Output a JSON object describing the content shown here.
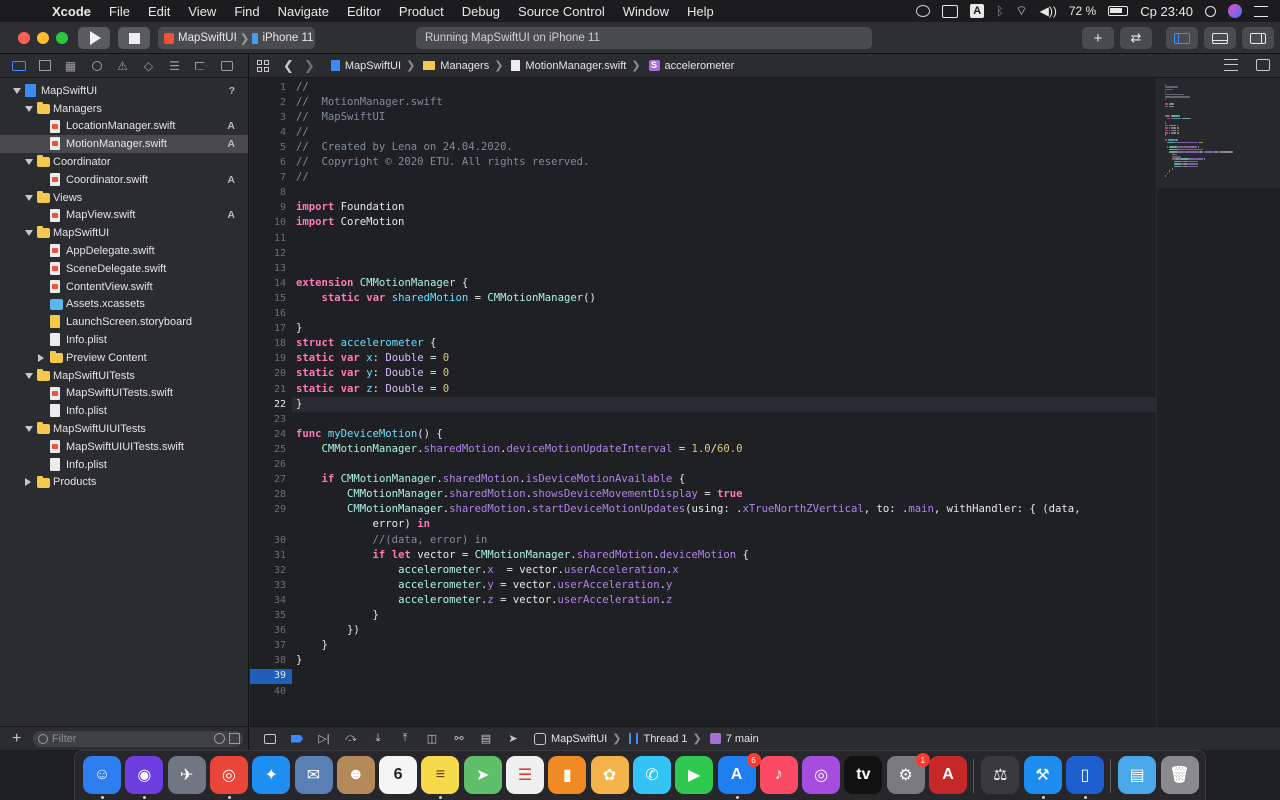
{
  "menubar": {
    "app_name": "Xcode",
    "items": [
      "File",
      "Edit",
      "View",
      "Find",
      "Navigate",
      "Editor",
      "Product",
      "Debug",
      "Source Control",
      "Window",
      "Help"
    ],
    "battery": "72 %",
    "keyboard": "A",
    "clock": "Ср 23:40"
  },
  "toolbar": {
    "scheme_project": "MapSwiftUI",
    "scheme_device": "iPhone 11",
    "activity_status": "Running MapSwiftUI on iPhone 11"
  },
  "navigator": {
    "filter_placeholder": "Filter",
    "tree": [
      {
        "label": "MapSwiftUI",
        "kind": "project",
        "depth": 0,
        "expanded": true,
        "badge": "?"
      },
      {
        "label": "Managers",
        "kind": "folder",
        "depth": 1,
        "expanded": true,
        "badge": ""
      },
      {
        "label": "LocationManager.swift",
        "kind": "swift",
        "depth": 2,
        "badge": "A"
      },
      {
        "label": "MotionManager.swift",
        "kind": "swift",
        "depth": 2,
        "badge": "A",
        "selected": true
      },
      {
        "label": "Coordinator",
        "kind": "folder",
        "depth": 1,
        "expanded": true,
        "badge": ""
      },
      {
        "label": "Coordinator.swift",
        "kind": "swift",
        "depth": 2,
        "badge": "A"
      },
      {
        "label": "Views",
        "kind": "folder",
        "depth": 1,
        "expanded": true,
        "badge": ""
      },
      {
        "label": "MapView.swift",
        "kind": "swift",
        "depth": 2,
        "badge": "A"
      },
      {
        "label": "MapSwiftUI",
        "kind": "folder",
        "depth": 1,
        "expanded": true,
        "badge": ""
      },
      {
        "label": "AppDelegate.swift",
        "kind": "swift",
        "depth": 2,
        "badge": ""
      },
      {
        "label": "SceneDelegate.swift",
        "kind": "swift",
        "depth": 2,
        "badge": ""
      },
      {
        "label": "ContentView.swift",
        "kind": "swift",
        "depth": 2,
        "badge": ""
      },
      {
        "label": "Assets.xcassets",
        "kind": "assets",
        "depth": 2,
        "badge": ""
      },
      {
        "label": "LaunchScreen.storyboard",
        "kind": "storyboard",
        "depth": 2,
        "badge": ""
      },
      {
        "label": "Info.plist",
        "kind": "file",
        "depth": 2,
        "badge": ""
      },
      {
        "label": "Preview Content",
        "kind": "folder",
        "depth": 2,
        "expanded": false,
        "badge": ""
      },
      {
        "label": "MapSwiftUITests",
        "kind": "folder",
        "depth": 1,
        "expanded": true,
        "badge": ""
      },
      {
        "label": "MapSwiftUITests.swift",
        "kind": "swift",
        "depth": 2,
        "badge": ""
      },
      {
        "label": "Info.plist",
        "kind": "file",
        "depth": 2,
        "badge": ""
      },
      {
        "label": "MapSwiftUIUITests",
        "kind": "folder",
        "depth": 1,
        "expanded": true,
        "badge": ""
      },
      {
        "label": "MapSwiftUIUITests.swift",
        "kind": "swift",
        "depth": 2,
        "badge": ""
      },
      {
        "label": "Info.plist",
        "kind": "file",
        "depth": 2,
        "badge": ""
      },
      {
        "label": "Products",
        "kind": "folder",
        "depth": 1,
        "expanded": false,
        "badge": ""
      }
    ]
  },
  "jumpbar": {
    "crumbs": [
      {
        "label": "MapSwiftUI",
        "icon": "proj"
      },
      {
        "label": "Managers",
        "icon": "fold"
      },
      {
        "label": "MotionManager.swift",
        "icon": "file"
      },
      {
        "label": "accelerometer",
        "icon": "struct"
      }
    ]
  },
  "editor": {
    "current_line": 22,
    "breakpoint_line": 39,
    "lines": [
      {
        "n": "1",
        "t": [
          [
            "c",
            "//"
          ]
        ]
      },
      {
        "n": "2",
        "t": [
          [
            "c",
            "//  MotionManager.swift"
          ]
        ]
      },
      {
        "n": "3",
        "t": [
          [
            "c",
            "//  MapSwiftUI"
          ]
        ]
      },
      {
        "n": "4",
        "t": [
          [
            "c",
            "//"
          ]
        ]
      },
      {
        "n": "5",
        "t": [
          [
            "c",
            "//  Created by Lena on 24.04.2020."
          ]
        ]
      },
      {
        "n": "6",
        "t": [
          [
            "c",
            "//  Copyright © 2020 ETU. All rights reserved."
          ]
        ]
      },
      {
        "n": "7",
        "t": [
          [
            "c",
            "//"
          ]
        ]
      },
      {
        "n": "8",
        "t": []
      },
      {
        "n": "9",
        "t": [
          [
            "k",
            "import"
          ],
          [
            "p",
            " Foundation"
          ]
        ]
      },
      {
        "n": "10",
        "t": [
          [
            "k",
            "import"
          ],
          [
            "p",
            " CoreMotion"
          ]
        ]
      },
      {
        "n": "11",
        "t": []
      },
      {
        "n": "12",
        "t": []
      },
      {
        "n": "13",
        "t": []
      },
      {
        "n": "14",
        "t": [
          [
            "k",
            "extension"
          ],
          [
            "p",
            " "
          ],
          [
            "cl",
            "CMMotionManager"
          ],
          [
            "p",
            " {"
          ]
        ]
      },
      {
        "n": "15",
        "t": [
          [
            "p",
            "    "
          ],
          [
            "k",
            "static"
          ],
          [
            "p",
            " "
          ],
          [
            "k",
            "var"
          ],
          [
            "p",
            " "
          ],
          [
            "d",
            "sharedMotion"
          ],
          [
            "p",
            " = "
          ],
          [
            "cl",
            "CMMotionManager"
          ],
          [
            "p",
            "()"
          ]
        ]
      },
      {
        "n": "16",
        "t": []
      },
      {
        "n": "17",
        "t": [
          [
            "p",
            "}"
          ]
        ]
      },
      {
        "n": "18",
        "t": [
          [
            "k",
            "struct"
          ],
          [
            "p",
            " "
          ],
          [
            "d",
            "accelerometer"
          ],
          [
            "p",
            " {"
          ]
        ]
      },
      {
        "n": "19",
        "t": [
          [
            "k",
            "static"
          ],
          [
            "p",
            " "
          ],
          [
            "k",
            "var"
          ],
          [
            "p",
            " "
          ],
          [
            "d",
            "x"
          ],
          [
            "p",
            ": "
          ],
          [
            "ty",
            "Double"
          ],
          [
            "p",
            " = "
          ],
          [
            "n",
            "0"
          ]
        ]
      },
      {
        "n": "20",
        "t": [
          [
            "k",
            "static"
          ],
          [
            "p",
            " "
          ],
          [
            "k",
            "var"
          ],
          [
            "p",
            " "
          ],
          [
            "d",
            "y"
          ],
          [
            "p",
            ": "
          ],
          [
            "ty",
            "Double"
          ],
          [
            "p",
            " = "
          ],
          [
            "n",
            "0"
          ]
        ]
      },
      {
        "n": "21",
        "t": [
          [
            "k",
            "static"
          ],
          [
            "p",
            " "
          ],
          [
            "k",
            "var"
          ],
          [
            "p",
            " "
          ],
          [
            "d",
            "z"
          ],
          [
            "p",
            ": "
          ],
          [
            "ty",
            "Double"
          ],
          [
            "p",
            " = "
          ],
          [
            "n",
            "0"
          ]
        ]
      },
      {
        "n": "22",
        "t": [
          [
            "p",
            "}"
          ]
        ]
      },
      {
        "n": "23",
        "t": []
      },
      {
        "n": "24",
        "t": [
          [
            "k",
            "func"
          ],
          [
            "p",
            " "
          ],
          [
            "d",
            "myDeviceMotion"
          ],
          [
            "p",
            "() {"
          ]
        ]
      },
      {
        "n": "25",
        "t": [
          [
            "p",
            "    "
          ],
          [
            "cl",
            "CMMotionManager"
          ],
          [
            "p",
            "."
          ],
          [
            "m",
            "sharedMotion"
          ],
          [
            "p",
            "."
          ],
          [
            "m",
            "deviceMotionUpdateInterval"
          ],
          [
            "p",
            " = "
          ],
          [
            "n",
            "1.0"
          ],
          [
            "p",
            "/"
          ],
          [
            "n",
            "60.0"
          ]
        ]
      },
      {
        "n": "26",
        "t": []
      },
      {
        "n": "27",
        "t": [
          [
            "p",
            "    "
          ],
          [
            "k",
            "if"
          ],
          [
            "p",
            " "
          ],
          [
            "cl",
            "CMMotionManager"
          ],
          [
            "p",
            "."
          ],
          [
            "m",
            "sharedMotion"
          ],
          [
            "p",
            "."
          ],
          [
            "m",
            "isDeviceMotionAvailable"
          ],
          [
            "p",
            " {"
          ]
        ]
      },
      {
        "n": "28",
        "t": [
          [
            "p",
            "        "
          ],
          [
            "cl",
            "CMMotionManager"
          ],
          [
            "p",
            "."
          ],
          [
            "m",
            "sharedMotion"
          ],
          [
            "p",
            "."
          ],
          [
            "m",
            "showsDeviceMovementDisplay"
          ],
          [
            "p",
            " = "
          ],
          [
            "k",
            "true"
          ]
        ]
      },
      {
        "n": "29",
        "t": [
          [
            "p",
            "        "
          ],
          [
            "cl",
            "CMMotionManager"
          ],
          [
            "p",
            "."
          ],
          [
            "m",
            "sharedMotion"
          ],
          [
            "p",
            "."
          ],
          [
            "m",
            "startDeviceMotionUpdates"
          ],
          [
            "p",
            "(using: ."
          ],
          [
            "m",
            "xTrueNorthZVertical"
          ],
          [
            "p",
            ", to: ."
          ],
          [
            "m",
            "main"
          ],
          [
            "p",
            ", withHandler: { (data,"
          ]
        ]
      },
      {
        "n": "",
        "t": [
          [
            "p",
            "            error) "
          ],
          [
            "k",
            "in"
          ]
        ]
      },
      {
        "n": "30",
        "t": [
          [
            "p",
            "            "
          ],
          [
            "c",
            "//(data, error) in"
          ]
        ]
      },
      {
        "n": "31",
        "t": [
          [
            "p",
            "            "
          ],
          [
            "k",
            "if"
          ],
          [
            "p",
            " "
          ],
          [
            "k",
            "let"
          ],
          [
            "p",
            " vector = "
          ],
          [
            "cl",
            "CMMotionManager"
          ],
          [
            "p",
            "."
          ],
          [
            "m",
            "sharedMotion"
          ],
          [
            "p",
            "."
          ],
          [
            "m",
            "deviceMotion"
          ],
          [
            "p",
            " {"
          ]
        ]
      },
      {
        "n": "32",
        "t": [
          [
            "p",
            "                "
          ],
          [
            "f",
            "accelerometer"
          ],
          [
            "p",
            "."
          ],
          [
            "m",
            "x"
          ],
          [
            "p",
            "  = vector."
          ],
          [
            "m",
            "userAcceleration"
          ],
          [
            "p",
            "."
          ],
          [
            "m",
            "x"
          ]
        ]
      },
      {
        "n": "33",
        "t": [
          [
            "p",
            "                "
          ],
          [
            "f",
            "accelerometer"
          ],
          [
            "p",
            "."
          ],
          [
            "m",
            "y"
          ],
          [
            "p",
            " = vector."
          ],
          [
            "m",
            "userAcceleration"
          ],
          [
            "p",
            "."
          ],
          [
            "m",
            "y"
          ]
        ]
      },
      {
        "n": "34",
        "t": [
          [
            "p",
            "                "
          ],
          [
            "f",
            "accelerometer"
          ],
          [
            "p",
            "."
          ],
          [
            "m",
            "z"
          ],
          [
            "p",
            " = vector."
          ],
          [
            "m",
            "userAcceleration"
          ],
          [
            "p",
            "."
          ],
          [
            "m",
            "z"
          ]
        ]
      },
      {
        "n": "35",
        "t": [
          [
            "p",
            "            }"
          ]
        ]
      },
      {
        "n": "36",
        "t": [
          [
            "p",
            "        })"
          ]
        ]
      },
      {
        "n": "37",
        "t": [
          [
            "p",
            "    }"
          ]
        ]
      },
      {
        "n": "38",
        "t": [
          [
            "p",
            "}"
          ]
        ]
      },
      {
        "n": "39",
        "t": []
      },
      {
        "n": "40",
        "t": []
      }
    ]
  },
  "debugbar": {
    "crumbs": [
      "MapSwiftUI",
      "Thread 1",
      "7 main"
    ]
  },
  "dock": {
    "apps": [
      {
        "name": "finder-icon",
        "color": "#2d7ff0",
        "glyph": "☺"
      },
      {
        "name": "siri-icon",
        "color": "#6d3de0",
        "glyph": "◉"
      },
      {
        "name": "launchpad-icon",
        "color": "#6f7782",
        "glyph": "✈"
      },
      {
        "name": "chrome-icon",
        "color": "#e9453a",
        "glyph": "◎"
      },
      {
        "name": "safari-icon",
        "color": "#1f8ef1",
        "glyph": "✦"
      },
      {
        "name": "mail-icon",
        "color": "#5a7fb5",
        "glyph": "✉"
      },
      {
        "name": "contacts-icon",
        "color": "#b48a5a",
        "glyph": "☻"
      },
      {
        "name": "calendar-icon",
        "color": "#f5f5f5",
        "glyph": "6",
        "text_color": "#222"
      },
      {
        "name": "notes-icon",
        "color": "#f7d94c",
        "glyph": "≡",
        "text_color": "#5a4a10"
      },
      {
        "name": "maps-icon",
        "color": "#5fbf6a",
        "glyph": "➤"
      },
      {
        "name": "reminders-icon",
        "color": "#f0f0f0",
        "glyph": "☰",
        "text_color": "#e04030"
      },
      {
        "name": "books-icon",
        "color": "#f08a24",
        "glyph": "▮"
      },
      {
        "name": "photos-icon",
        "color": "#f3b34a",
        "glyph": "✿"
      },
      {
        "name": "messages-icon",
        "color": "#34c3f5",
        "glyph": "✆"
      },
      {
        "name": "facetime-icon",
        "color": "#2fc94f",
        "glyph": "▶"
      },
      {
        "name": "app-store-icon",
        "color": "#1f7ef0",
        "glyph": "A",
        "badge": "6"
      },
      {
        "name": "music-icon",
        "color": "#fa4a66",
        "glyph": "♪"
      },
      {
        "name": "podcasts-icon",
        "color": "#a64de0",
        "glyph": "◎"
      },
      {
        "name": "apple-tv-icon",
        "color": "#111111",
        "glyph": "tv"
      },
      {
        "name": "system-preferences-icon",
        "color": "#7a7a7e",
        "glyph": "⚙",
        "badge": "1"
      },
      {
        "name": "autocad-icon",
        "color": "#c62828",
        "glyph": "A"
      },
      {
        "name": "instruments-icon",
        "color": "#3a3a3e",
        "glyph": "⚖"
      },
      {
        "name": "xcode-icon",
        "color": "#1d8df0",
        "glyph": "⚒"
      },
      {
        "name": "simulator-icon",
        "color": "#1e5fd0",
        "glyph": "▯"
      },
      {
        "name": "downloads-folder-icon",
        "color": "#4aa8e8",
        "glyph": "▤"
      },
      {
        "name": "trash-icon",
        "color": "#8a8a8e",
        "glyph": "🗑"
      }
    ]
  }
}
